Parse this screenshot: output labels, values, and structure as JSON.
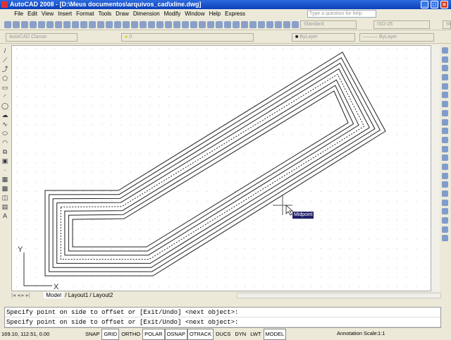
{
  "window": {
    "title": "AutoCAD 2008 - [D:\\Meus documentos\\arquivos_cad\\xline.dwg]"
  },
  "menu": [
    "File",
    "Edit",
    "View",
    "Insert",
    "Format",
    "Tools",
    "Draw",
    "Dimension",
    "Modify",
    "Window",
    "Help",
    "Express"
  ],
  "help_search": {
    "placeholder": "Type a question for help"
  },
  "toolbar": {
    "text_style": "Standard",
    "dim_style": "ISO-25",
    "table_style": "Standard",
    "workspace": "AutoCAD Classic",
    "layer": "0",
    "color": "ByLayer",
    "linetype": "ByLayer"
  },
  "draw_tools": [
    "line",
    "construction-line",
    "polyline",
    "polygon",
    "rectangle",
    "arc",
    "circle",
    "revision-cloud",
    "spline",
    "ellipse",
    "ellipse-arc",
    "insert-block",
    "make-block",
    "point",
    "hatch",
    "gradient",
    "region",
    "table",
    "multiline-text"
  ],
  "tabs": [
    "Model",
    "Layout1",
    "Layout2"
  ],
  "tooltip": "Midpoint",
  "axis": {
    "x": "X",
    "y": "Y"
  },
  "command_lines": [
    "Specify point on side to offset or [Exit/Undo] <next object>:",
    "Specify point on side to offset or [Exit/Undo] <next object>:"
  ],
  "status": {
    "coords": "169.10, 112.51, 0.00",
    "toggles": [
      {
        "label": "SNAP",
        "on": false
      },
      {
        "label": "GRID",
        "on": true
      },
      {
        "label": "ORTHO",
        "on": false
      },
      {
        "label": "POLAR",
        "on": true
      },
      {
        "label": "OSNAP",
        "on": true
      },
      {
        "label": "OTRACK",
        "on": true
      },
      {
        "label": "DUCS",
        "on": false
      },
      {
        "label": "DYN",
        "on": false
      },
      {
        "label": "LWT",
        "on": false
      },
      {
        "label": "MODEL",
        "on": true
      }
    ],
    "annotation_scale_label": "Annotation Scale:",
    "annotation_scale": "1:1"
  }
}
